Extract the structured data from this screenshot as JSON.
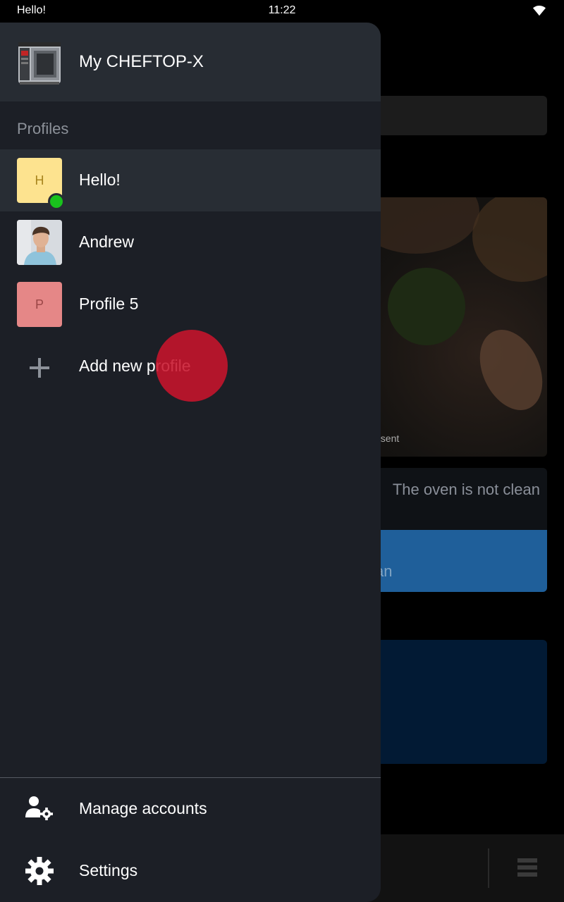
{
  "status_bar": {
    "left_text": "Hello!",
    "time": "11:22",
    "wifi_icon": "wifi-icon"
  },
  "background": {
    "hero_caption": "esent",
    "notice_text": "The oven is not clean",
    "notice_button_text": "an"
  },
  "drawer": {
    "device_name": "My CHEFTOP-X",
    "section_title": "Profiles",
    "profiles": [
      {
        "initial": "H",
        "name": "Hello!",
        "active": true,
        "online": true,
        "color": "#fde38f"
      },
      {
        "initial": "",
        "name": "Andrew",
        "active": false,
        "online": false,
        "photo": true
      },
      {
        "initial": "P",
        "name": "Profile 5",
        "active": false,
        "online": false,
        "color": "#e58787"
      }
    ],
    "add_profile_label": "Add new profile",
    "footer": {
      "manage_accounts_label": "Manage accounts",
      "settings_label": "Settings"
    }
  },
  "colors": {
    "drawer_bg": "#1c1f26",
    "header_bg": "#272c33",
    "online": "#19c21d",
    "touch_indicator": "#c8142c"
  }
}
